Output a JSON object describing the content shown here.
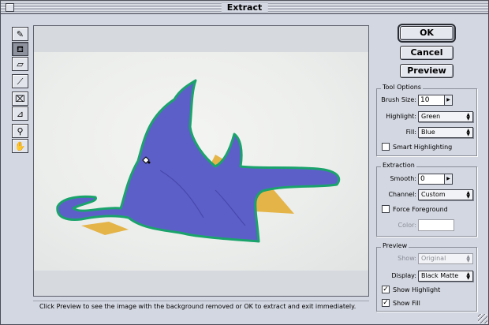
{
  "window": {
    "title": "Extract"
  },
  "tools": [
    {
      "name": "edge-highlighter-icon",
      "glyph": "✎",
      "selected": false
    },
    {
      "name": "fill-bucket-icon",
      "glyph": "⛾",
      "selected": true
    },
    {
      "name": "eraser-icon",
      "glyph": "▱",
      "selected": false
    },
    {
      "name": "eyedropper-icon",
      "glyph": "⟋",
      "selected": false
    },
    {
      "name": "cleanup-icon",
      "glyph": "⌧",
      "selected": false
    },
    {
      "name": "edge-touchup-icon",
      "glyph": "⊿",
      "selected": false
    },
    {
      "name": "zoom-icon",
      "glyph": "⚲",
      "selected": false
    },
    {
      "name": "hand-icon",
      "glyph": "✋",
      "selected": false
    }
  ],
  "buttons": {
    "ok": "OK",
    "cancel": "Cancel",
    "preview": "Preview"
  },
  "tool_options": {
    "label": "Tool Options",
    "brush_size_label": "Brush Size:",
    "brush_size": "10",
    "highlight_label": "Highlight:",
    "highlight": "Green",
    "fill_label": "Fill:",
    "fill": "Blue",
    "smart_label": "Smart Highlighting",
    "smart_checked": false
  },
  "extraction": {
    "label": "Extraction",
    "smooth_label": "Smooth:",
    "smooth": "0",
    "channel_label": "Channel:",
    "channel": "Custom",
    "force_label": "Force Foreground",
    "force_checked": false,
    "color_label": "Color:"
  },
  "preview": {
    "label": "Preview",
    "show_label": "Show:",
    "show": "Original",
    "display_label": "Display:",
    "display": "Black Matte",
    "show_highlight_label": "Show Highlight",
    "show_highlight_checked": true,
    "show_fill_label": "Show Fill",
    "show_fill_checked": true
  },
  "status": "Click Preview to see the image with the background removed or OK to extract and exit immediately.",
  "colors": {
    "highlight": "#1aa36b",
    "fill": "#5d5fc9",
    "window": "#d3d7e1"
  }
}
